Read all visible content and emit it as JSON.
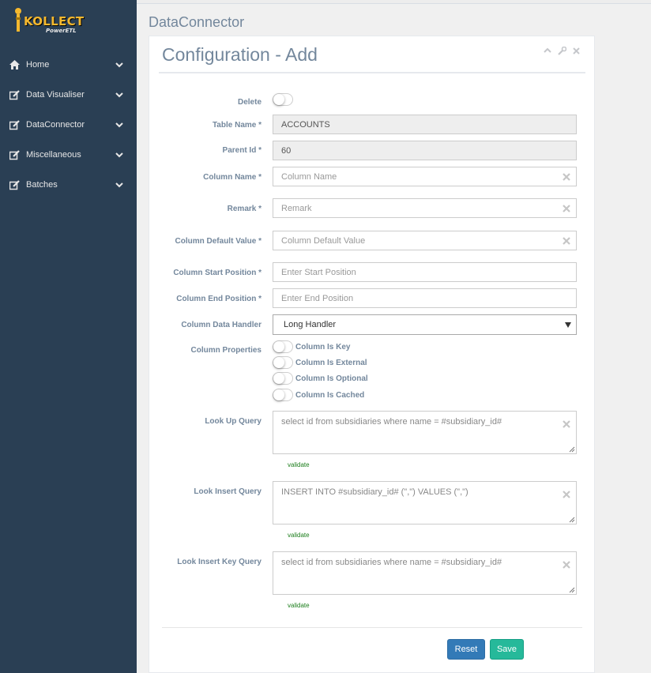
{
  "brand": {
    "name": "KOLLECT",
    "sub": "PowerETL"
  },
  "sidebar": {
    "items": [
      {
        "label": "Home",
        "icon": "home-icon"
      },
      {
        "label": "Data Visualiser",
        "icon": "edit-icon"
      },
      {
        "label": "DataConnector",
        "icon": "edit-icon"
      },
      {
        "label": "Miscellaneous",
        "icon": "edit-icon"
      },
      {
        "label": "Batches",
        "icon": "edit-icon"
      }
    ]
  },
  "page": {
    "title": "DataConnector"
  },
  "panel": {
    "title": "Configuration - Add"
  },
  "form": {
    "delete": {
      "label": "Delete",
      "on": false
    },
    "table_name": {
      "label": "Table Name *",
      "value": "ACCOUNTS"
    },
    "parent_id": {
      "label": "Parent Id *",
      "value": "60"
    },
    "column_name": {
      "label": "Column Name *",
      "placeholder": "Column Name"
    },
    "remark": {
      "label": "Remark *",
      "placeholder": "Remark"
    },
    "column_default_value": {
      "label": "Column Default Value *",
      "placeholder": "Column Default Value"
    },
    "column_start_position": {
      "label": "Column Start Position *",
      "placeholder": "Enter Start Position"
    },
    "column_end_position": {
      "label": "Column End Position *",
      "placeholder": "Enter End Position"
    },
    "column_data_handler": {
      "label": "Column Data Handler",
      "selected": "Long Handler"
    },
    "column_properties": {
      "label": "Column Properties",
      "options": [
        {
          "label": "Column Is Key",
          "on": false
        },
        {
          "label": "Column Is External",
          "on": false
        },
        {
          "label": "Column Is Optional",
          "on": false
        },
        {
          "label": "Column Is Cached",
          "on": false
        }
      ]
    },
    "look_up_query": {
      "label": "Look Up Query",
      "value": "select id from subsidiaries where name = #subsidiary_id#",
      "validate": "validate"
    },
    "look_insert_query": {
      "label": "Look Insert Query",
      "value": "INSERT INTO #subsidiary_id# (\",\") VALUES (\",\")",
      "validate": "validate"
    },
    "look_insert_key_query": {
      "label": "Look Insert Key Query",
      "value": "select id from subsidiaries where name = #subsidiary_id#",
      "validate": "validate"
    }
  },
  "buttons": {
    "reset": "Reset",
    "save": "Save"
  },
  "colors": {
    "sidebar": "#2a3f54",
    "reset": "#337ab7",
    "save": "#26b99a",
    "validate": "#1a7d1a"
  }
}
